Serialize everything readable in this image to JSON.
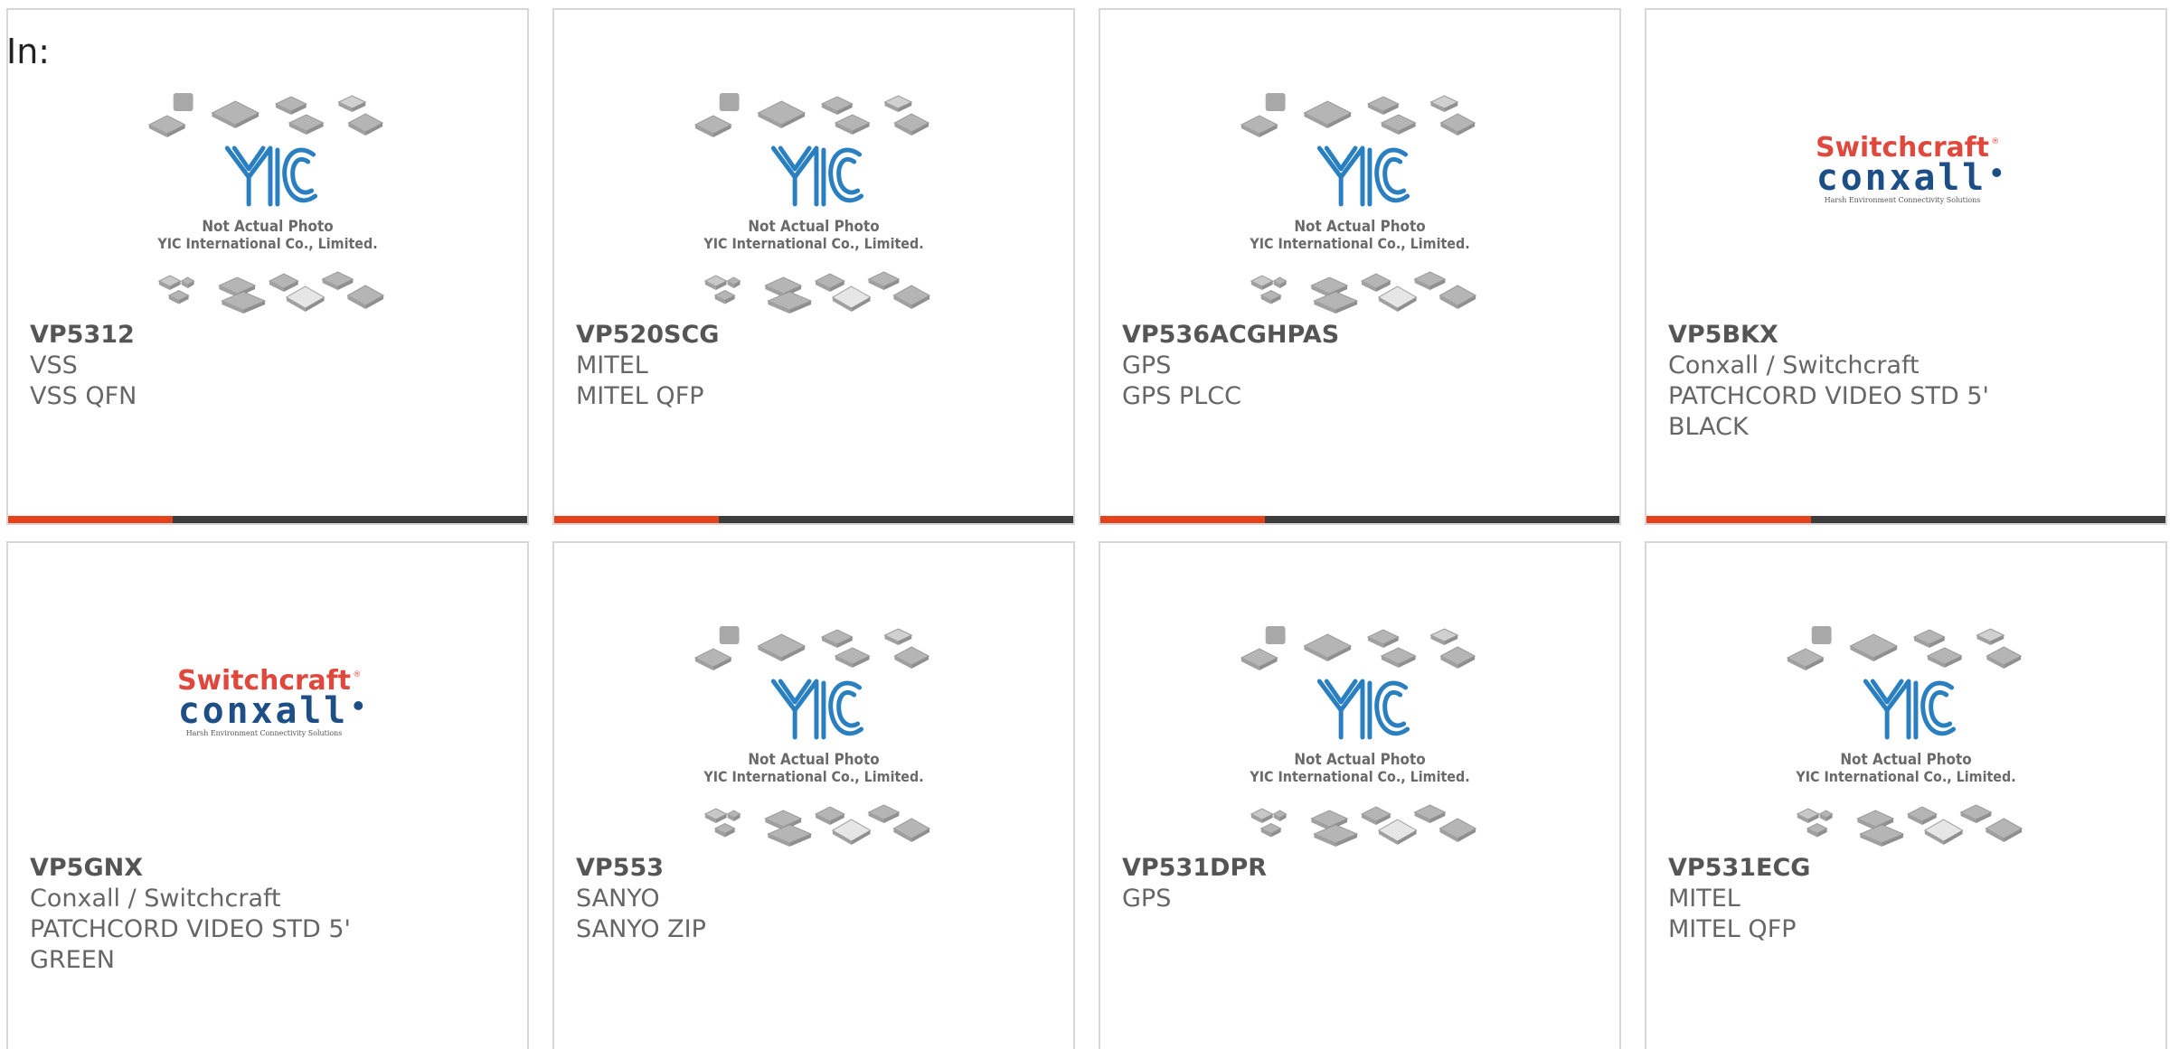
{
  "page": {
    "in_label": "In:"
  },
  "placeholder_photo": {
    "line1": "Not Actual Photo",
    "line2": "YIC International Co., Limited."
  },
  "switchcraft_logo": {
    "top": "Switchcraft",
    "mark": "®",
    "bottom": "conxall",
    "tagline": "Harsh Environment Connectivity Solutions"
  },
  "colors": {
    "accent": "#e5411a",
    "bar": "#3d3d3d",
    "yic_blue": "#2a7fc0",
    "chip_gray": "#b5b5b5",
    "switchcraft_red": "#e0473d",
    "conxall_blue": "#1d4f86"
  },
  "products": [
    {
      "part": "VP5312",
      "lines": [
        "VSS",
        "VSS QFN"
      ],
      "image": "placeholder-photo"
    },
    {
      "part": "VP520SCG",
      "lines": [
        "MITEL",
        "MITEL QFP"
      ],
      "image": "placeholder-photo"
    },
    {
      "part": "VP536ACGHPAS",
      "lines": [
        "GPS",
        "GPS PLCC"
      ],
      "image": "placeholder-photo"
    },
    {
      "part": "VP5BKX",
      "lines": [
        "Conxall / Switchcraft",
        "PATCHCORD VIDEO STD 5'",
        "BLACK"
      ],
      "image": "switchcraft-logo"
    },
    {
      "part": "VP5GNX",
      "lines": [
        "Conxall / Switchcraft",
        "PATCHCORD VIDEO STD 5'",
        "GREEN"
      ],
      "image": "switchcraft-logo"
    },
    {
      "part": "VP553",
      "lines": [
        "SANYO",
        "SANYO ZIP"
      ],
      "image": "placeholder-photo"
    },
    {
      "part": "VP531DPR",
      "lines": [
        "GPS"
      ],
      "image": "placeholder-photo"
    },
    {
      "part": "VP531ECG",
      "lines": [
        "MITEL",
        "MITEL QFP"
      ],
      "image": "placeholder-photo"
    }
  ]
}
